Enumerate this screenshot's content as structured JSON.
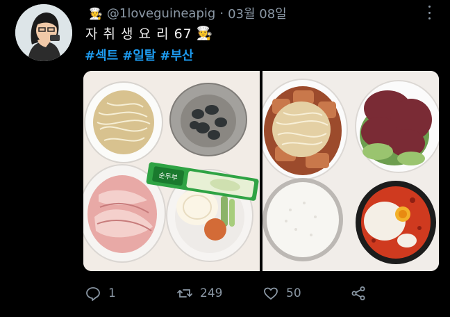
{
  "tweet": {
    "chef_emoji": "🧑‍🍳",
    "handle": "@1loveguineapig",
    "separator": "·",
    "date": "03월 08일",
    "title": "자 취 생 요 리 67",
    "title_emoji": "🧑‍🍳",
    "hashtags": [
      "#섹트",
      "#일탈",
      "#부산"
    ]
  },
  "product": {
    "brand": "순두부"
  },
  "actions": {
    "reply_count": "1",
    "retweet_count": "249",
    "like_count": "50"
  },
  "colors": {
    "background": "#000000",
    "text_muted": "#8b98a5",
    "hashtag": "#1d9bf0"
  },
  "icons": {
    "reply": "reply-icon",
    "retweet": "retweet-icon",
    "like": "heart-icon",
    "share": "share-icon",
    "more": "more-icon"
  }
}
